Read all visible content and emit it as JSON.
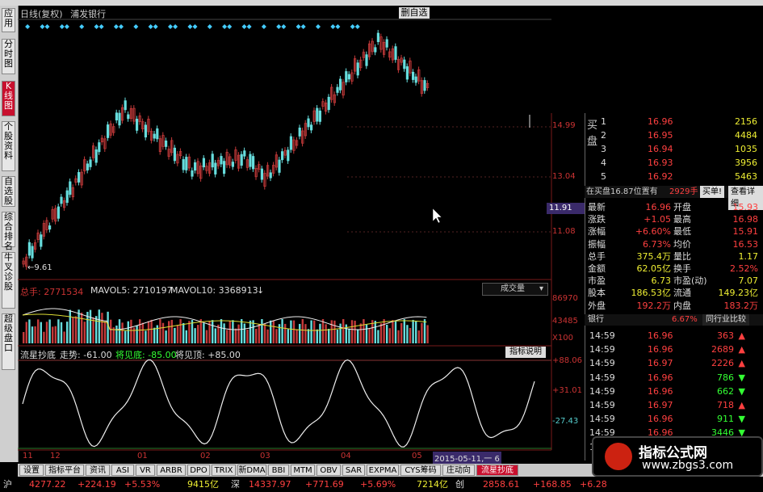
{
  "header": {
    "period": "日线(复权)",
    "stock_name": "浦发银行",
    "auto_select": "删自选"
  },
  "sidebar": {
    "items": [
      {
        "label": "应用",
        "active": false
      },
      {
        "label": "分时图",
        "active": false
      },
      {
        "label": "K线图",
        "active": true
      },
      {
        "label": "个股资料",
        "active": false
      },
      {
        "label": "自选股",
        "active": false
      },
      {
        "label": "综合排名",
        "active": false
      },
      {
        "label": "牛叉诊股",
        "active": false
      },
      {
        "label": "超级盘口",
        "active": false
      }
    ]
  },
  "price_axis": [
    "14.99",
    "13.04",
    "11.08"
  ],
  "current_price_tag": "11.91",
  "low_marker": "9.61",
  "volume_header": {
    "total": "总手: 2771534",
    "ma5": "MAVOL5: 2710197",
    "ma10": "MAVOL10: 3368913",
    "select": "成交量",
    "axis": [
      "86970",
      "43485",
      "X100"
    ]
  },
  "indicator_header": {
    "name": "流星抄底",
    "trend": "走势: -61.00",
    "bottom": "将见底: -85.00",
    "top": "将见顶: +85.00",
    "button": "指标说明",
    "axis": [
      "+88.06",
      "+31.01",
      "-27.43"
    ]
  },
  "x_axis": [
    "11",
    "12",
    "01",
    "02",
    "03",
    "04",
    "05"
  ],
  "cursor_date": "2015-05-11,一",
  "cursor_tail": "6",
  "order_book": {
    "side_label": "买盘",
    "bids": [
      {
        "level": "1",
        "price": "16.96",
        "vol": "2156"
      },
      {
        "level": "2",
        "price": "16.95",
        "vol": "4484"
      },
      {
        "level": "3",
        "price": "16.94",
        "vol": "1035"
      },
      {
        "level": "4",
        "price": "16.93",
        "vol": "3956"
      },
      {
        "level": "5",
        "price": "16.92",
        "vol": "5463"
      }
    ]
  },
  "mid_bar": {
    "text": "在买盘16.87位置有",
    "qty": "2929手",
    "buy_btn": "买单!",
    "detail_btn": "查看详细"
  },
  "quote": [
    {
      "l1": "最新",
      "v1": "16.96",
      "l2": "开盘",
      "v2": "15.93"
    },
    {
      "l1": "涨跌",
      "v1": "+1.05",
      "l2": "最高",
      "v2": "16.98"
    },
    {
      "l1": "涨幅",
      "v1": "+6.60%",
      "l2": "最低",
      "v2": "15.91"
    },
    {
      "l1": "振幅",
      "v1": "6.73%",
      "l2": "均价",
      "v2": "16.53"
    },
    {
      "l1": "总手",
      "v1": "375.4万",
      "l2": "量比",
      "v2": "1.17"
    },
    {
      "l1": "金额",
      "v1": "62.05亿",
      "l2": "换手",
      "v2": "2.52%"
    },
    {
      "l1": "市盈",
      "v1": "6.73",
      "l2": "市盈(动)",
      "v2": "7.07"
    },
    {
      "l1": "股本",
      "v1": "186.53亿",
      "l2": "流通",
      "v2": "149.23亿"
    },
    {
      "l1": "外盘",
      "v1": "192.2万",
      "l2": "内盘",
      "v2": "183.2万"
    }
  ],
  "industry_bar": {
    "name": "银行",
    "pct": "6.67%",
    "btn": "同行业比较"
  },
  "ticks": [
    {
      "time": "14:59",
      "price": "16.96",
      "vol": "363",
      "dir": "up"
    },
    {
      "time": "14:59",
      "price": "16.96",
      "vol": "2689",
      "dir": "up"
    },
    {
      "time": "14:59",
      "price": "16.97",
      "vol": "2226",
      "dir": "up"
    },
    {
      "time": "14:59",
      "price": "16.96",
      "vol": "786",
      "dir": "down"
    },
    {
      "time": "14:59",
      "price": "16.96",
      "vol": "662",
      "dir": "down"
    },
    {
      "time": "14:59",
      "price": "16.97",
      "vol": "718",
      "dir": "up"
    },
    {
      "time": "14:59",
      "price": "16.96",
      "vol": "911",
      "dir": "down"
    },
    {
      "time": "14:59",
      "price": "16.96",
      "vol": "3446",
      "dir": "down"
    },
    {
      "time": "15:",
      "price": "",
      "vol": "",
      "dir": ""
    }
  ],
  "tabs": [
    "设置",
    "指标平台",
    "资讯",
    "ASI",
    "VR",
    "ARBR",
    "DPO",
    "TRIX",
    "新DMA",
    "BBI",
    "MTM",
    "OBV",
    "SAR",
    "EXPMA",
    "CYS筹码",
    "庄动向",
    "流星抄底"
  ],
  "active_tab": "流星抄底",
  "status": {
    "market1": "沪",
    "idx1": "4277.22",
    "chg1": "+224.19",
    "pct1": "+5.53%",
    "amt1": "9415亿",
    "market2": "深",
    "idx2": "14337.97",
    "chg2": "+771.69",
    "pct2": "+5.69%",
    "amt2": "7214亿",
    "market3": "创",
    "idx3": "2858.61",
    "chg3": "+168.85",
    "pct3": "+6.28"
  },
  "watermark": {
    "title": "指标公式网",
    "url": "www.zbgs3.com"
  },
  "colors": {
    "up": "#ff4040",
    "down": "#5ee",
    "accent": "#c8102e"
  }
}
